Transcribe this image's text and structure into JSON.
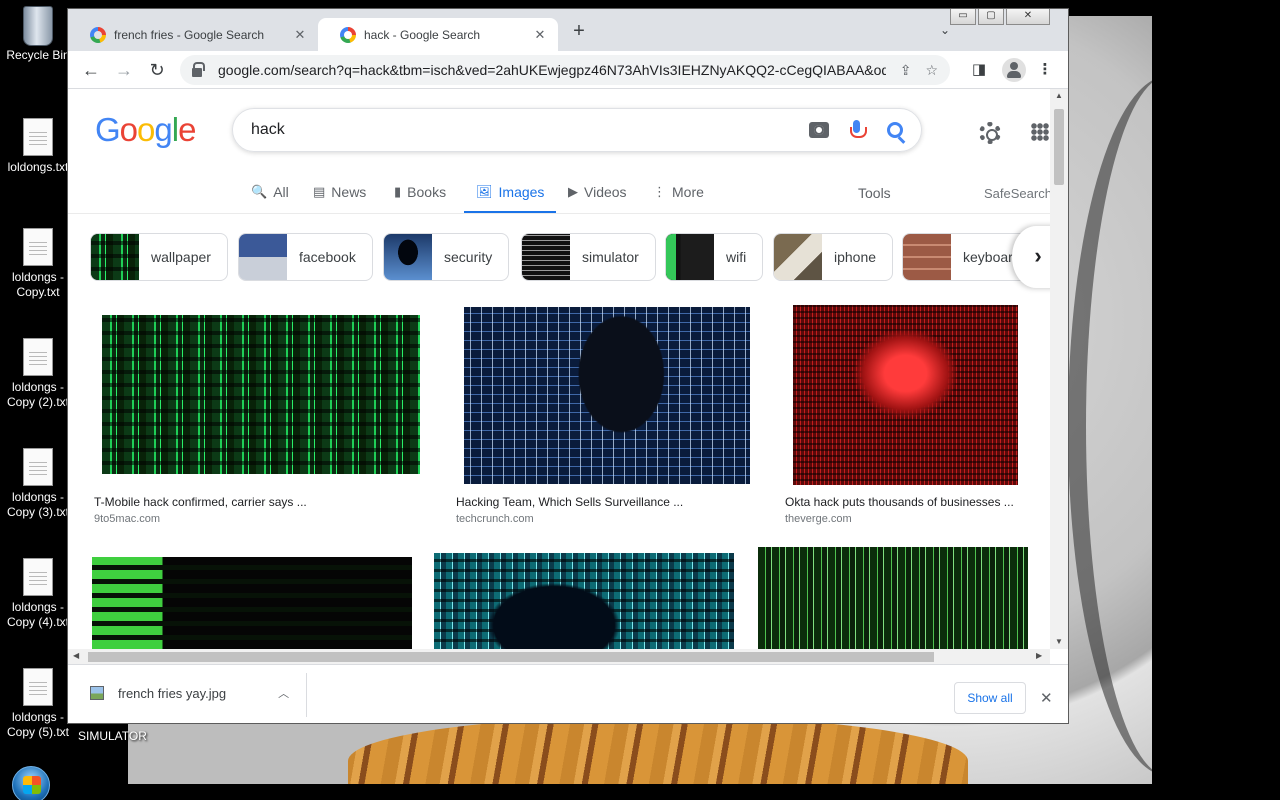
{
  "desktop": {
    "icons": [
      {
        "label": "Recycle Bin",
        "type": "bin"
      },
      {
        "label": "loldongs.txt",
        "type": "file"
      },
      {
        "label": "loldongs - Copy.txt",
        "type": "file"
      },
      {
        "label": "loldongs - Copy (2).txt",
        "type": "file"
      },
      {
        "label": "loldongs - Copy (3).txt",
        "type": "file"
      },
      {
        "label": "loldongs - Copy (4).txt",
        "type": "file"
      },
      {
        "label": "loldongs - Copy (5).txt",
        "type": "file"
      }
    ],
    "simulator_label": "SIMULATOR"
  },
  "browser": {
    "tabs": [
      {
        "title": "french fries - Google Search",
        "active": false
      },
      {
        "title": "hack - Google Search",
        "active": true
      }
    ],
    "new_tab_glyph": "+",
    "tab_search_glyph": "⌄",
    "url": "google.com/search?q=hack&tbm=isch&ved=2ahUKEwjegpz46N73AhVIs3IEHZNyAKQQ2-cCegQIABAA&oq...",
    "window_buttons": [
      "▭",
      "▢",
      "✕"
    ]
  },
  "google": {
    "query": "hack",
    "tabs": [
      {
        "label": "All",
        "icon": "🔍"
      },
      {
        "label": "News",
        "icon": "▤"
      },
      {
        "label": "Books",
        "icon": "▮"
      },
      {
        "label": "Images",
        "icon": "🖼"
      },
      {
        "label": "Videos",
        "icon": "▶"
      },
      {
        "label": "More",
        "icon": "⋮"
      }
    ],
    "tools_label": "Tools",
    "safesearch_label": "SafeSearch",
    "chips": [
      "wallpaper",
      "facebook",
      "security",
      "simulator",
      "wifi",
      "iphone",
      "keyboard"
    ],
    "results": [
      {
        "title": "T-Mobile hack confirmed, carrier says ...",
        "source": "9to5mac.com"
      },
      {
        "title": "Hacking Team, Which Sells Surveillance ...",
        "source": "techcrunch.com"
      },
      {
        "title": "Okta hack puts thousands of businesses ...",
        "source": "theverge.com"
      },
      {
        "title": "",
        "source": ""
      },
      {
        "title": "",
        "source": ""
      },
      {
        "title": "",
        "source": ""
      }
    ]
  },
  "downloads": {
    "file_name": "french fries yay.jpg",
    "show_all_label": "Show all"
  },
  "colors": {
    "google_blue": "#4285f4",
    "google_red": "#ea4335",
    "google_yellow": "#fbbc05",
    "google_green": "#34a853",
    "selected_tab": "#1a73e8"
  }
}
